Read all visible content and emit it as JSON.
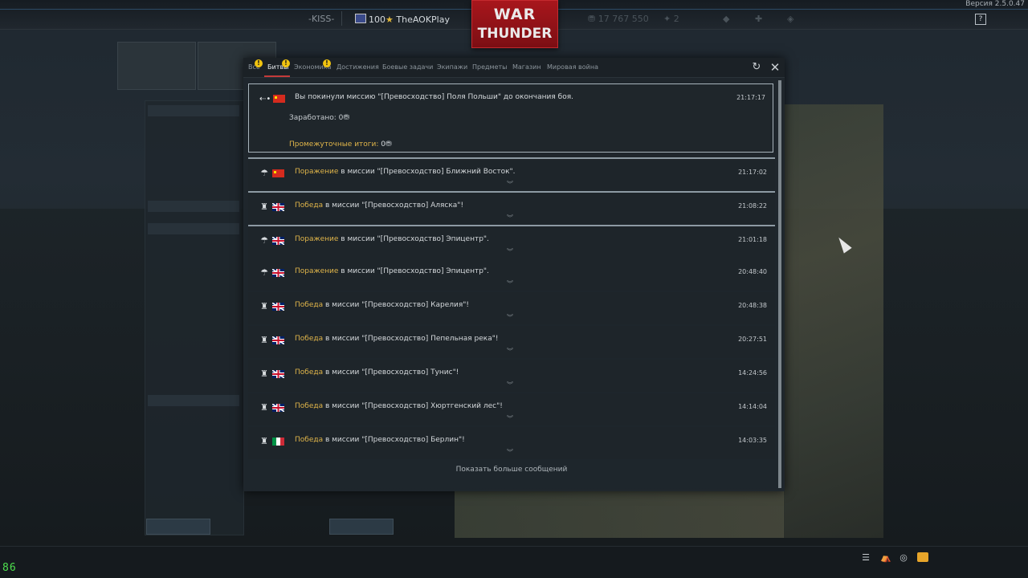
{
  "version": "Версия 2.5.0.47",
  "topbar": {
    "squad": "-KISS-",
    "level": "100",
    "player": "TheAOKPlay",
    "silver": "17 767 550",
    "gold": "2"
  },
  "logo": {
    "line1": "WAR",
    "line2": "THUNDER"
  },
  "tabs": [
    {
      "label": "Все",
      "warn": true
    },
    {
      "label": "Битвы",
      "warn": true,
      "active": true
    },
    {
      "label": "Экономика",
      "warn": true
    },
    {
      "label": "Достижения"
    },
    {
      "label": "Боевые задачи"
    },
    {
      "label": "Экипажи"
    },
    {
      "label": "Предметы"
    },
    {
      "label": "Магазин"
    },
    {
      "label": "Мировая война"
    }
  ],
  "warn_mark": "!",
  "first_message": {
    "text": "Вы покинули миссию \"[Превосходство] Поля Польши\" до окончания боя.",
    "time": "21:17:17",
    "earned_label": "Заработано: 0",
    "interim_label": "Промежуточные итоги:",
    "interim_value": "0"
  },
  "messages": [
    {
      "result": "Поражение",
      "rest": " в миссии \"[Превосходство] Ближний Восток\".",
      "time": "21:17:02",
      "flag": "cn",
      "icon": "parachute"
    },
    {
      "result": "Победа",
      "rest": " в миссии \"[Превосходство] Аляска\"!",
      "time": "21:08:22",
      "flag": "uk",
      "icon": "trophy"
    },
    {
      "result": "Поражение",
      "rest": " в миссии \"[Превосходство] Эпицентр\".",
      "time": "21:01:18",
      "flag": "uk",
      "icon": "parachute"
    },
    {
      "result": "Поражение",
      "rest": " в миссии \"[Превосходство] Эпицентр\".",
      "time": "20:48:40",
      "flag": "uk",
      "icon": "parachute"
    },
    {
      "result": "Победа",
      "rest": " в миссии \"[Превосходство] Карелия\"!",
      "time": "20:48:38",
      "flag": "uk",
      "icon": "trophy"
    },
    {
      "result": "Победа",
      "rest": " в миссии \"[Превосходство] Пепельная река\"!",
      "time": "20:27:51",
      "flag": "uk",
      "icon": "trophy"
    },
    {
      "result": "Победа",
      "rest": " в миссии \"[Превосходство] Тунис\"!",
      "time": "14:24:56",
      "flag": "uk",
      "icon": "trophy"
    },
    {
      "result": "Победа",
      "rest": " в миссии \"[Превосходство] Хюртгенский лес\"!",
      "time": "14:14:04",
      "flag": "uk",
      "icon": "trophy"
    },
    {
      "result": "Победа",
      "rest": " в миссии \"[Превосходство] Берлин\"!",
      "time": "14:03:35",
      "flag": "it",
      "icon": "trophy"
    }
  ],
  "show_more": "Показать больше сообщений",
  "help_label": "?",
  "fps": "86",
  "icons": {
    "back": "back-arrow-icon",
    "refresh": "refresh-icon",
    "close": "close-icon",
    "trophy": "trophy-icon",
    "parachute": "parachute-icon"
  },
  "colors": {
    "accent_gold": "#e0b54a",
    "logo_red": "#a8161c",
    "tab_underline": "#c43a3a"
  }
}
